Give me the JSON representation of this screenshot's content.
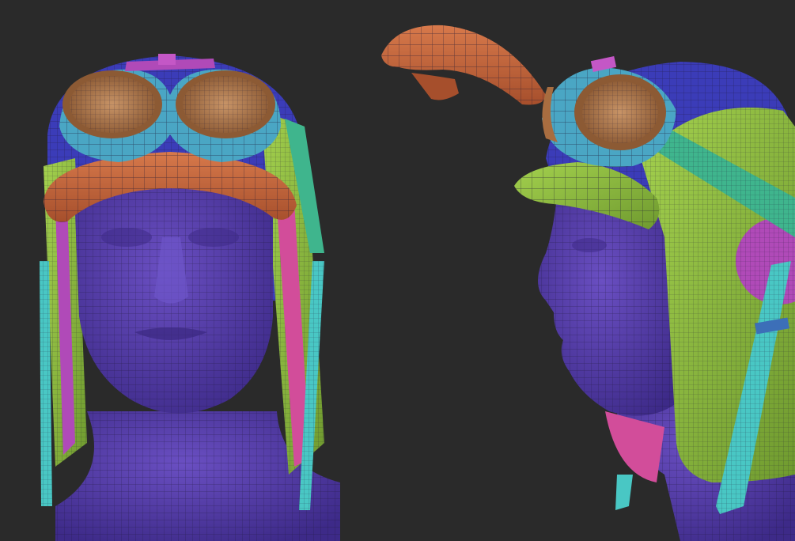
{
  "scene": {
    "background": "#2a2a2a",
    "wire_color": "#1b1633",
    "palette": {
      "skin": "#5b3fb0",
      "skin_shade": "#3e2a86",
      "cap_top": "#3b3cb8",
      "goggle_rim": "#4aa6c4",
      "goggle_lens": "#b07a4c",
      "visor": "#c8693f",
      "flap_green": "#8fbf3f",
      "strap_teal": "#3fb58d",
      "magenta": "#b04ab8",
      "trim_pink": "#d24d9a",
      "cyan_strap": "#49c7c4"
    },
    "objects": [
      {
        "name": "front-view-head-with-aviator-helmet"
      },
      {
        "name": "detached-visor-piece"
      },
      {
        "name": "side-view-head-with-aviator-helmet"
      }
    ]
  }
}
